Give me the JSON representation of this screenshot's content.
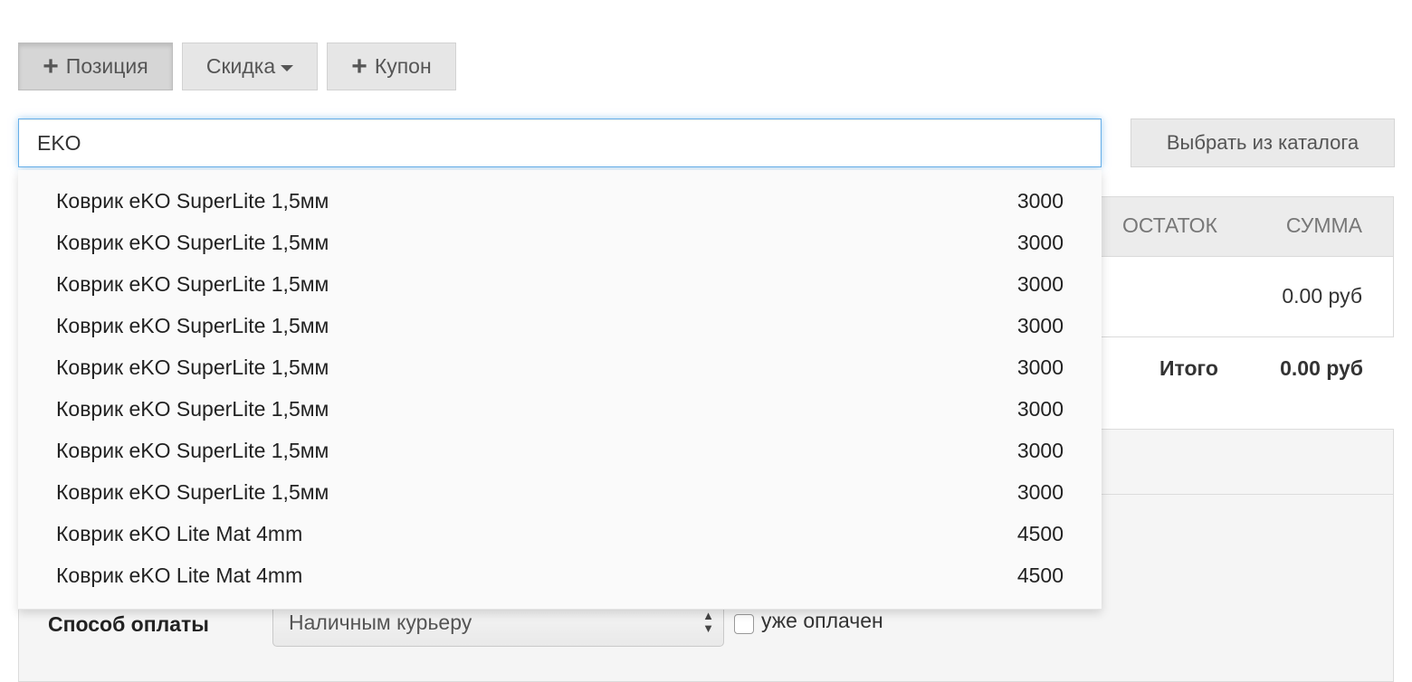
{
  "toolbar": {
    "add_position": "Позиция",
    "discount": "Скидка",
    "coupon": "Купон"
  },
  "search": {
    "value": "EKO",
    "catalog_button": "Выбрать из каталога"
  },
  "table": {
    "headers": [
      "ОСТАТОК",
      "СУММА"
    ],
    "row_amount": "0.00 руб",
    "total_label": "Итого",
    "total_value": "0.00 руб"
  },
  "payment": {
    "label": "Способ оплаты",
    "selected": "Наличным курьеру",
    "paid_label": "уже оплачен"
  },
  "suggestions": [
    {
      "name": "Коврик eKO SuperLite 1,5мм",
      "price": "3000"
    },
    {
      "name": "Коврик eKO SuperLite 1,5мм",
      "price": "3000"
    },
    {
      "name": "Коврик eKO SuperLite 1,5мм",
      "price": "3000"
    },
    {
      "name": "Коврик eKO SuperLite 1,5мм",
      "price": "3000"
    },
    {
      "name": "Коврик eKO SuperLite 1,5мм",
      "price": "3000"
    },
    {
      "name": "Коврик eKO SuperLite 1,5мм",
      "price": "3000"
    },
    {
      "name": "Коврик eKO SuperLite 1,5мм",
      "price": "3000"
    },
    {
      "name": "Коврик eKO SuperLite 1,5мм",
      "price": "3000"
    },
    {
      "name": "Коврик eKO Lite Mat 4mm",
      "price": "4500"
    },
    {
      "name": "Коврик eKO Lite Mat 4mm",
      "price": "4500"
    }
  ],
  "colors": {
    "focus": "#66afe9",
    "button_bg": "#e6e6e6",
    "panel_bg": "#f5f5f5"
  },
  "icons": {
    "plus": "+",
    "select_arrows": "▲▼"
  }
}
